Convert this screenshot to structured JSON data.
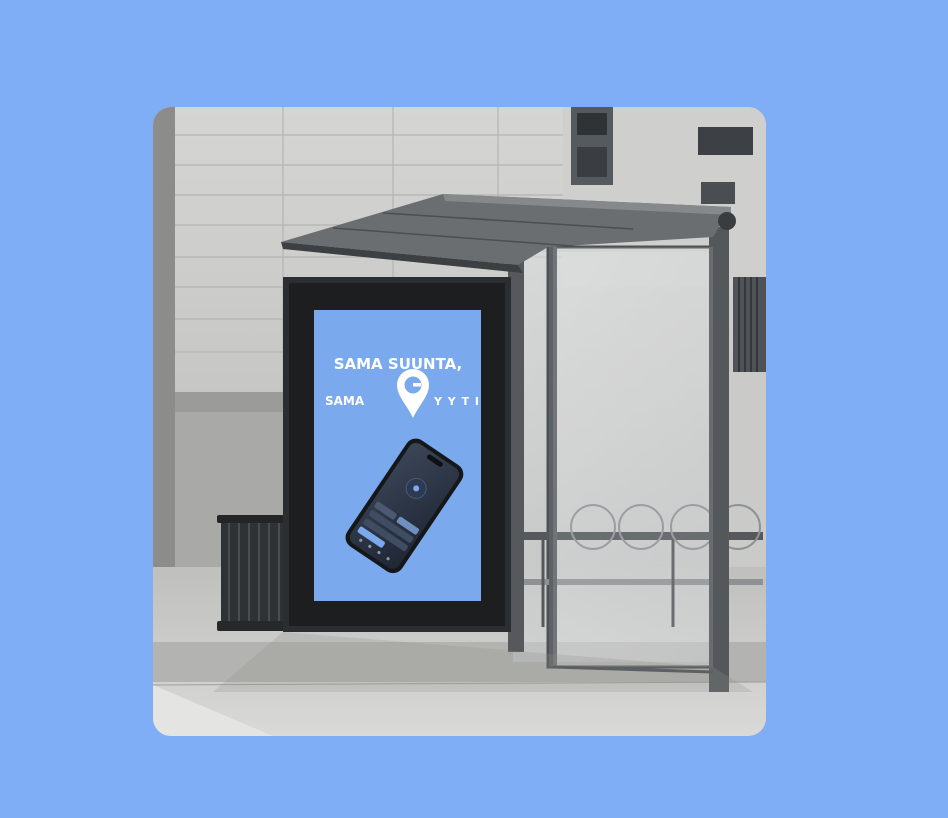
{
  "colors": {
    "page_background": "#80aef6",
    "poster_background": "#7ba9ee",
    "poster_text": "#ffffff"
  },
  "poster": {
    "headline_line1": "SAMA SUUNTA,",
    "headline_line2_prefix": "SAMA",
    "brand_letter": "G",
    "brand_rest": "Y Y T I"
  },
  "icons": [
    "map-pin-icon",
    "smartphone"
  ]
}
